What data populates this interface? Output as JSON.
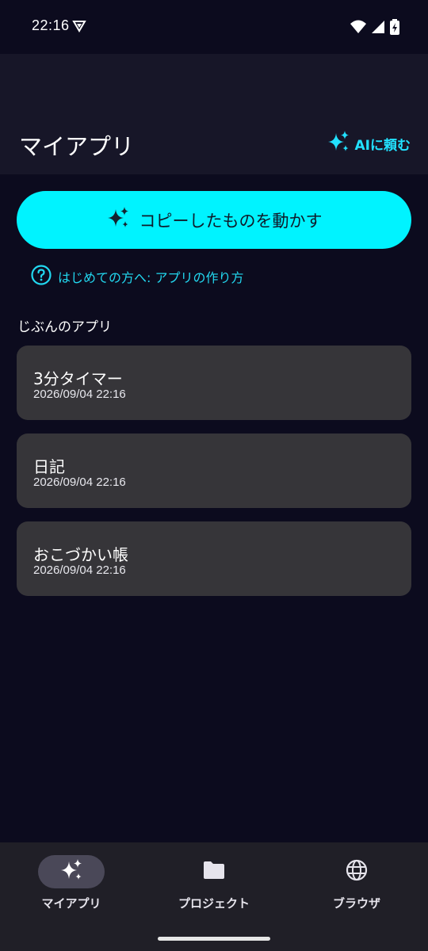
{
  "status": {
    "time": "22:16",
    "icons": [
      "vpn-shield-icon",
      "wifi-icon",
      "signal-icon",
      "battery-icon"
    ]
  },
  "appbar": {
    "title": "マイアプリ",
    "ask_ai_label": "AIに頼む"
  },
  "main": {
    "run_button_label": "コピーしたものを動かす",
    "help_link_label": "はじめての方へ: アプリの作り方",
    "section_title": "じぶんのアプリ",
    "apps": [
      {
        "name": "3分タイマー",
        "date": "2026/09/04 22:16"
      },
      {
        "name": "日記",
        "date": "2026/09/04 22:16"
      },
      {
        "name": "おこづかい帳",
        "date": "2026/09/04 22:16"
      }
    ]
  },
  "nav": {
    "items": [
      {
        "label": "マイアプリ",
        "icon": "sparkle-icon",
        "active": true
      },
      {
        "label": "プロジェクト",
        "icon": "folder-icon",
        "active": false
      },
      {
        "label": "ブラウザ",
        "icon": "globe-icon",
        "active": false
      }
    ]
  },
  "colors": {
    "accent": "#00f3ff",
    "background": "#0c0b1e",
    "card": "#363539",
    "appbar": "#171628",
    "nav": "#201f27"
  }
}
